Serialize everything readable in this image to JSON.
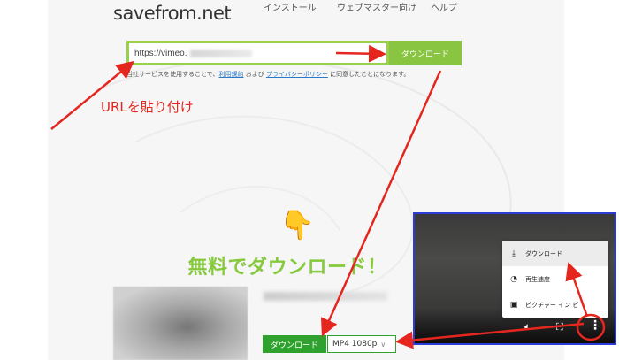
{
  "header": {
    "logo": "savefrom.net",
    "nav": [
      "インストール",
      "ウェブマスター向け",
      "ヘルプ"
    ]
  },
  "form": {
    "url_value": "https://vimeo.",
    "download_label": "ダウンロード",
    "terms_prefix": "当社サービスを使用することで、",
    "terms_link1": "利用規約",
    "terms_middle": " および ",
    "terms_link2": "プライバシーポリシー",
    "terms_suffix": " に同意したことになります。"
  },
  "annotation": {
    "paste_url": "URLを貼り付け"
  },
  "promo": {
    "title": "無料でダウンロード！"
  },
  "result": {
    "download_label": "ダウンロード",
    "format": "MP4  1080p"
  },
  "player": {
    "menu": [
      {
        "icon": "download-icon",
        "label": "ダウンロード"
      },
      {
        "icon": "speed-icon",
        "label": "再生速度"
      },
      {
        "icon": "pip-icon",
        "label": "ピクチャー イン ピ"
      }
    ]
  },
  "colors": {
    "brand_green": "#89c540",
    "dark_green": "#2fa12f",
    "annotation_red": "#e4261f",
    "link_blue": "#2a78c8",
    "player_border": "#2a3bd6"
  }
}
